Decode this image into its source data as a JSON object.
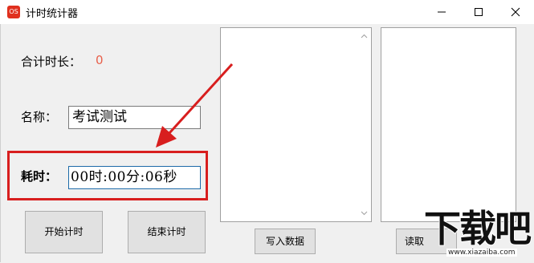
{
  "window": {
    "title": "计时统计器",
    "icon_text": "OS"
  },
  "form": {
    "total_label": "合计时长：",
    "total_value": "0",
    "name_label": "名称：",
    "name_value": "考试测试",
    "elapsed_label": "耗时：",
    "elapsed_value": "00时:00分:06秒"
  },
  "buttons": {
    "start": "开始计时",
    "end": "结束计时",
    "write": "写入数据",
    "read": "读取"
  },
  "watermark": {
    "text": "下载吧",
    "url": "www.xiazaiba.com"
  },
  "colors": {
    "accent_red": "#d81e1e",
    "total_value_color": "#e8604b",
    "focus_border": "#1c6aa8"
  }
}
